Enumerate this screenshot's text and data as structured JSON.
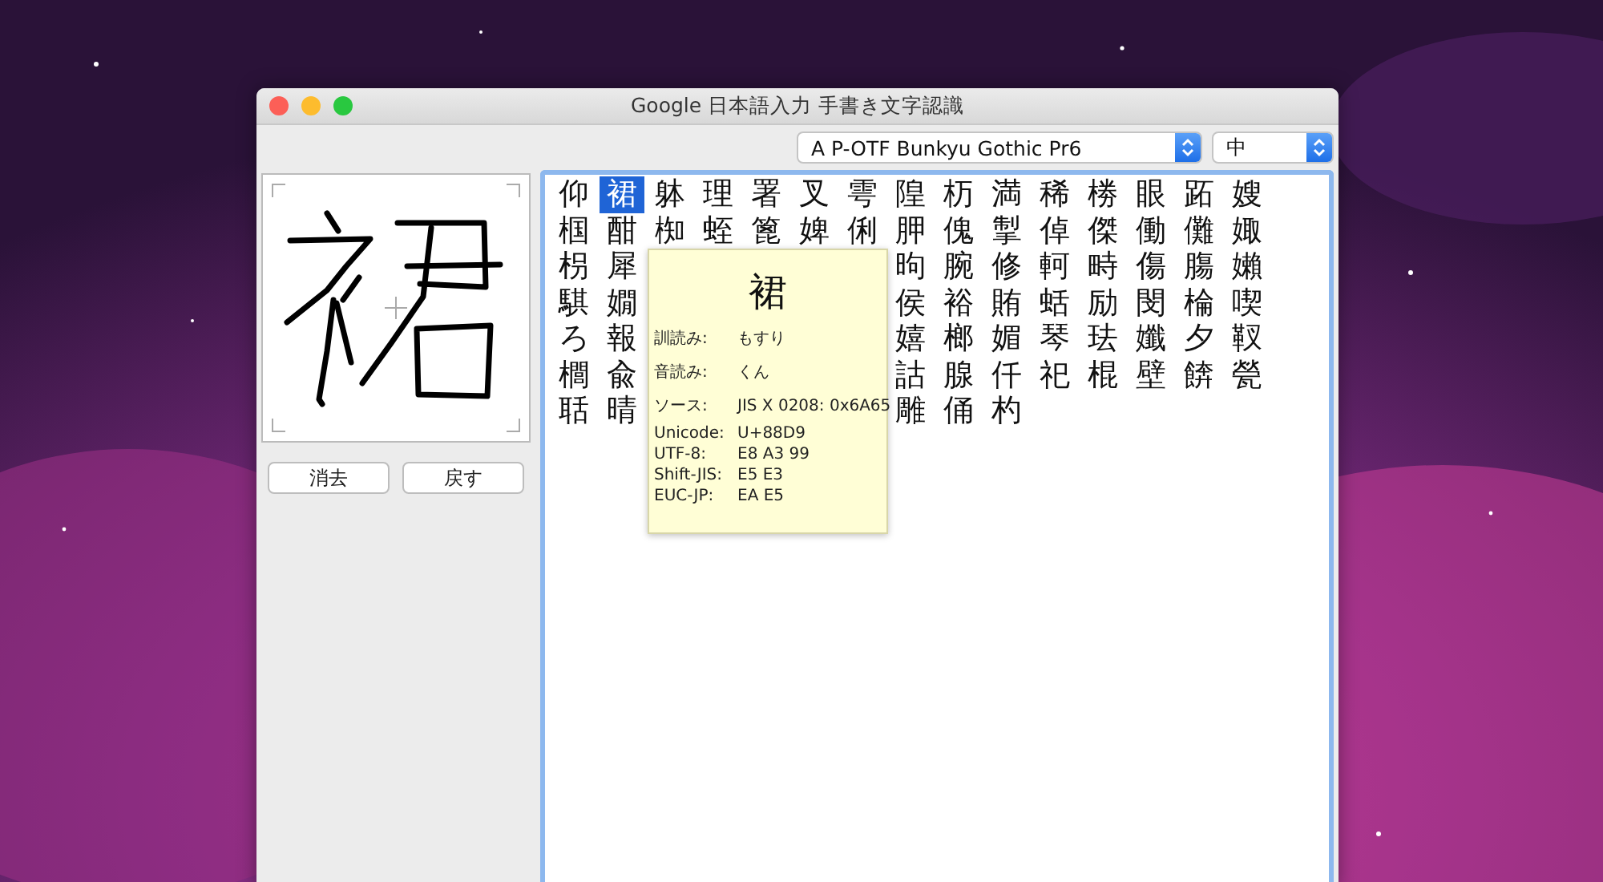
{
  "window": {
    "title": "Google 日本語入力 手書き文字認識"
  },
  "font_select": {
    "value": "A P-OTF Bunkyu Gothic Pr6"
  },
  "size_select": {
    "value": "中"
  },
  "buttons": [
    "消去",
    "戻す"
  ],
  "candidates": [
    {
      "row": [
        {
          "char": "仰",
          "selected": false
        },
        {
          "char": "裙",
          "selected": true
        },
        {
          "char": "躰",
          "selected": false
        },
        {
          "char": "理",
          "selected": false
        },
        {
          "char": "署",
          "selected": false
        },
        {
          "char": "叉",
          "selected": false
        },
        {
          "char": "雩",
          "selected": false
        },
        {
          "char": "隍",
          "selected": false
        },
        {
          "char": "杤",
          "selected": false
        },
        {
          "char": "満",
          "selected": false
        },
        {
          "char": "稀",
          "selected": false
        },
        {
          "char": "椦",
          "selected": false
        },
        {
          "char": "眼",
          "selected": false
        },
        {
          "char": "跖",
          "selected": false
        },
        {
          "char": "嫂",
          "selected": false
        }
      ]
    },
    {
      "row": [
        {
          "char": "椢",
          "selected": false
        },
        {
          "char": "酣",
          "selected": false
        },
        {
          "char": "椥",
          "selected": false
        },
        {
          "char": "蛭",
          "selected": false
        },
        {
          "char": "篦",
          "selected": false
        },
        {
          "char": "婢",
          "selected": false
        },
        {
          "char": "俐",
          "selected": false
        },
        {
          "char": "胛",
          "selected": false
        },
        {
          "char": "傀",
          "selected": false
        },
        {
          "char": "掣",
          "selected": false
        },
        {
          "char": "倬",
          "selected": false
        },
        {
          "char": "傑",
          "selected": false
        },
        {
          "char": "働",
          "selected": false
        },
        {
          "char": "儺",
          "selected": false
        },
        {
          "char": "娵",
          "selected": false
        }
      ]
    },
    {
      "row": [
        {
          "char": "枴",
          "selected": false
        },
        {
          "char": "犀",
          "selected": false
        },
        {
          "char": "昫",
          "selected": false
        },
        {
          "char": "腕",
          "selected": false
        },
        {
          "char": "修",
          "selected": false
        },
        {
          "char": "軻",
          "selected": false
        },
        {
          "char": "畤",
          "selected": false
        },
        {
          "char": "傷",
          "selected": false
        },
        {
          "char": "膓",
          "selected": false
        },
        {
          "char": "嬾",
          "selected": false
        }
      ]
    },
    {
      "row": [
        {
          "char": "騏",
          "selected": false
        },
        {
          "char": "嫺",
          "selected": false
        },
        {
          "char": "侯",
          "selected": false
        },
        {
          "char": "裕",
          "selected": false
        },
        {
          "char": "賄",
          "selected": false
        },
        {
          "char": "蛞",
          "selected": false
        },
        {
          "char": "励",
          "selected": false
        },
        {
          "char": "閔",
          "selected": false
        },
        {
          "char": "棆",
          "selected": false
        },
        {
          "char": "喫",
          "selected": false
        }
      ]
    },
    {
      "row": [
        {
          "char": "ろ",
          "selected": false
        },
        {
          "char": "報",
          "selected": false
        },
        {
          "char": "嬉",
          "selected": false
        },
        {
          "char": "榔",
          "selected": false
        },
        {
          "char": "媚",
          "selected": false
        },
        {
          "char": "琴",
          "selected": false
        },
        {
          "char": "珐",
          "selected": false
        },
        {
          "char": "孅",
          "selected": false
        },
        {
          "char": "夕",
          "selected": false
        },
        {
          "char": "靫",
          "selected": false
        }
      ]
    },
    {
      "row": [
        {
          "char": "櫚",
          "selected": false
        },
        {
          "char": "兪",
          "selected": false
        },
        {
          "char": "詁",
          "selected": false
        },
        {
          "char": "腺",
          "selected": false
        },
        {
          "char": "仟",
          "selected": false
        },
        {
          "char": "祀",
          "selected": false
        },
        {
          "char": "棍",
          "selected": false
        },
        {
          "char": "壁",
          "selected": false
        },
        {
          "char": "餴",
          "selected": false
        },
        {
          "char": "甇",
          "selected": false
        }
      ]
    },
    {
      "row": [
        {
          "char": "聒",
          "selected": false
        },
        {
          "char": "晴",
          "selected": false
        },
        {
          "char": "雕",
          "selected": false
        },
        {
          "char": "俑",
          "selected": false
        },
        {
          "char": "杓",
          "selected": false
        }
      ]
    }
  ],
  "tooltip": {
    "char": "裙",
    "info": [
      {
        "label": "訓読み:",
        "value": "もすり"
      },
      {
        "label": "音読み:",
        "value": "くん"
      },
      {
        "label": "ソース:",
        "value": "JIS X 0208: 0x6A65"
      },
      {
        "label": "Unicode:",
        "value": "U+88D9"
      },
      {
        "label": "UTF-8:",
        "value": "E8 A3 99"
      },
      {
        "label": "Shift-JIS:",
        "value": "E5 E3"
      },
      {
        "label": "EUC-JP:",
        "value": "EA E5"
      }
    ]
  }
}
